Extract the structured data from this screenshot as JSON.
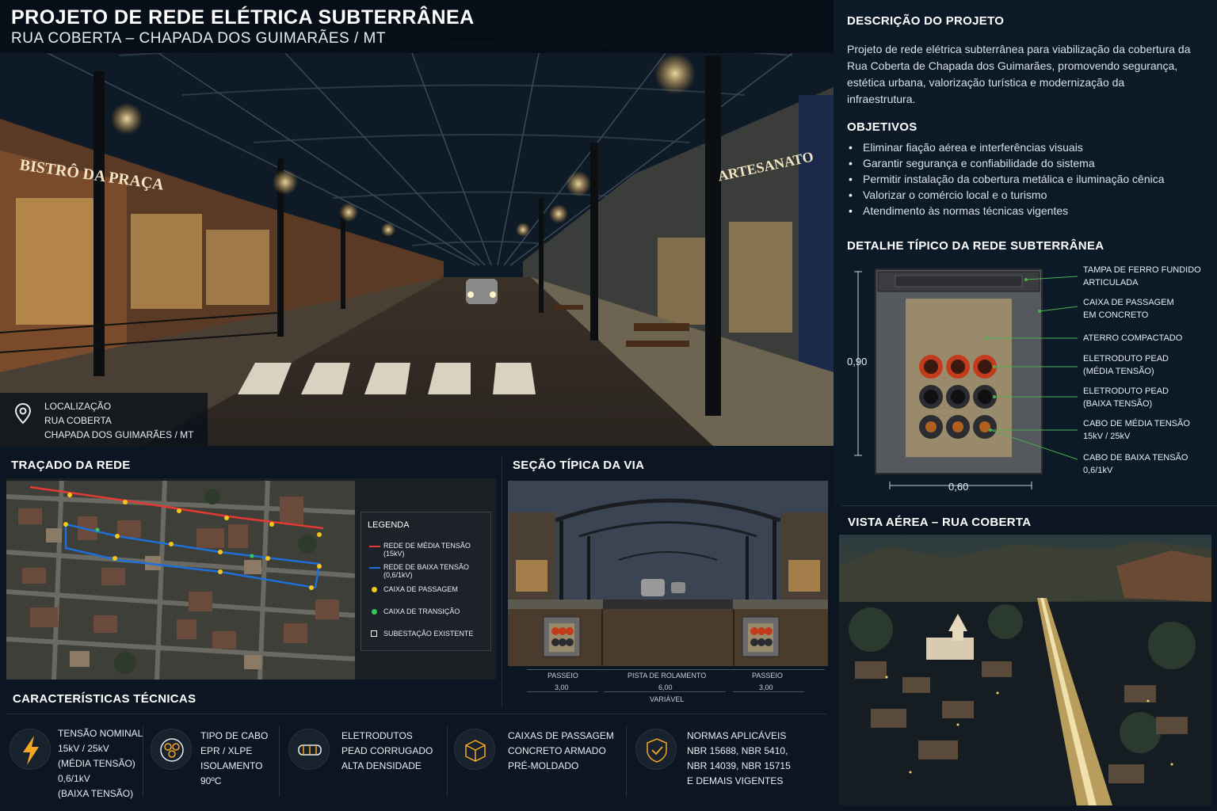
{
  "header": {
    "title": "PROJETO DE REDE ELÉTRICA SUBTERRÂNEA",
    "subtitle": "RUA COBERTA – CHAPADA DOS GUIMARÃES / MT"
  },
  "hero": {
    "sign_left": "BISTRÔ DA PRAÇA",
    "sign_right": "ARTESANATO"
  },
  "location": {
    "label": "LOCALIZAÇÃO",
    "street": "RUA COBERTA",
    "city": "CHAPADA DOS GUIMARÃES / MT"
  },
  "description": {
    "heading": "DESCRIÇÃO DO PROJETO",
    "text": "Projeto de rede elétrica subterrânea para viabilização da cobertura da Rua Coberta de Chapada dos Guimarães, promovendo segurança, estética urbana, valorização turística e modernização da infraestrutura."
  },
  "objectives": {
    "heading": "OBJETIVOS",
    "items": [
      "Eliminar fiação aérea e interferências visuais",
      "Garantir segurança e confiabilidade do sistema",
      "Permitir instalação da cobertura metálica e iluminação cênica",
      "Valorizar o comércio local e o turismo",
      "Atendimento às normas técnicas vigentes"
    ]
  },
  "detail": {
    "heading": "DETALHE TÍPICO DA REDE SUBTERRÂNEA",
    "height_dim": "0,90",
    "width_dim": "0,60",
    "labels": [
      {
        "l1": "TAMPA DE FERRO FUNDIDO",
        "l2": "ARTICULADA"
      },
      {
        "l1": "CAIXA DE PASSAGEM",
        "l2": "EM CONCRETO"
      },
      {
        "l1": "ATERRO COMPACTADO",
        "l2": ""
      },
      {
        "l1": "ELETRODUTO PEAD",
        "l2": "(MÉDIA TENSÃO)"
      },
      {
        "l1": "ELETRODUTO PEAD",
        "l2": "(BAIXA TENSÃO)"
      },
      {
        "l1": "CABO DE MÉDIA TENSÃO",
        "l2": "15kV / 25kV"
      },
      {
        "l1": "CABO DE BAIXA TENSÃO",
        "l2": "0,6/1kV"
      }
    ]
  },
  "network": {
    "heading": "TRAÇADO DA REDE",
    "legend_title": "LEGENDA",
    "legend": [
      {
        "label": "REDE DE MÉDIA TENSÃO (15kV)",
        "color": "#e53935",
        "kind": "line"
      },
      {
        "label": "REDE DE BAIXA TENSÃO (0,6/1kV)",
        "color": "#1e6fd9",
        "kind": "line"
      },
      {
        "label": "CAIXA DE PASSAGEM",
        "color": "#f5c518",
        "kind": "dot"
      },
      {
        "label": "CAIXA DE TRANSIÇÃO",
        "color": "#34c759",
        "kind": "dot"
      },
      {
        "label": "SUBESTAÇÃO EXISTENTE",
        "color": "#ffffff",
        "kind": "square"
      }
    ]
  },
  "section": {
    "heading": "SEÇÃO TÍPICA DA VIA",
    "left_label": "PASSEIO",
    "left_dim": "3,00",
    "center_label": "PISTA DE ROLAMENTO",
    "center_dim": "6,00",
    "center_note": "VARIÁVEL",
    "right_label": "PASSEIO",
    "right_dim": "3,00"
  },
  "tech": {
    "heading": "CARACTERÍSTICAS TÉCNICAS",
    "items": [
      {
        "icon": "lightning-icon",
        "lines": [
          "TENSÃO NOMINAL",
          "15kV / 25kV",
          "(MÉDIA TENSÃO)",
          "0,6/1kV",
          "(BAIXA TENSÃO)"
        ]
      },
      {
        "icon": "cable-icon",
        "lines": [
          "TIPO DE CABO",
          "EPR / XLPE",
          "ISOLAMENTO",
          "90ºC"
        ]
      },
      {
        "icon": "conduit-icon",
        "lines": [
          "ELETRODUTOS",
          "PEAD CORRUGADO",
          "ALTA DENSIDADE"
        ]
      },
      {
        "icon": "box-icon",
        "lines": [
          "CAIXAS DE PASSAGEM",
          "CONCRETO ARMADO",
          "PRÉ-MOLDADO"
        ]
      },
      {
        "icon": "shield-check-icon",
        "lines": [
          "NORMAS APLICÁVEIS",
          "NBR 15688, NBR 5410,",
          "NBR 14039, NBR 15715",
          "E DEMAIS VIGENTES"
        ]
      }
    ]
  },
  "aerial": {
    "heading": "VISTA  AÉREA – RUA COBERTA"
  },
  "colors": {
    "background": "#0b1622",
    "accent_orange": "#f5a623",
    "green_callout": "#4caf50"
  }
}
